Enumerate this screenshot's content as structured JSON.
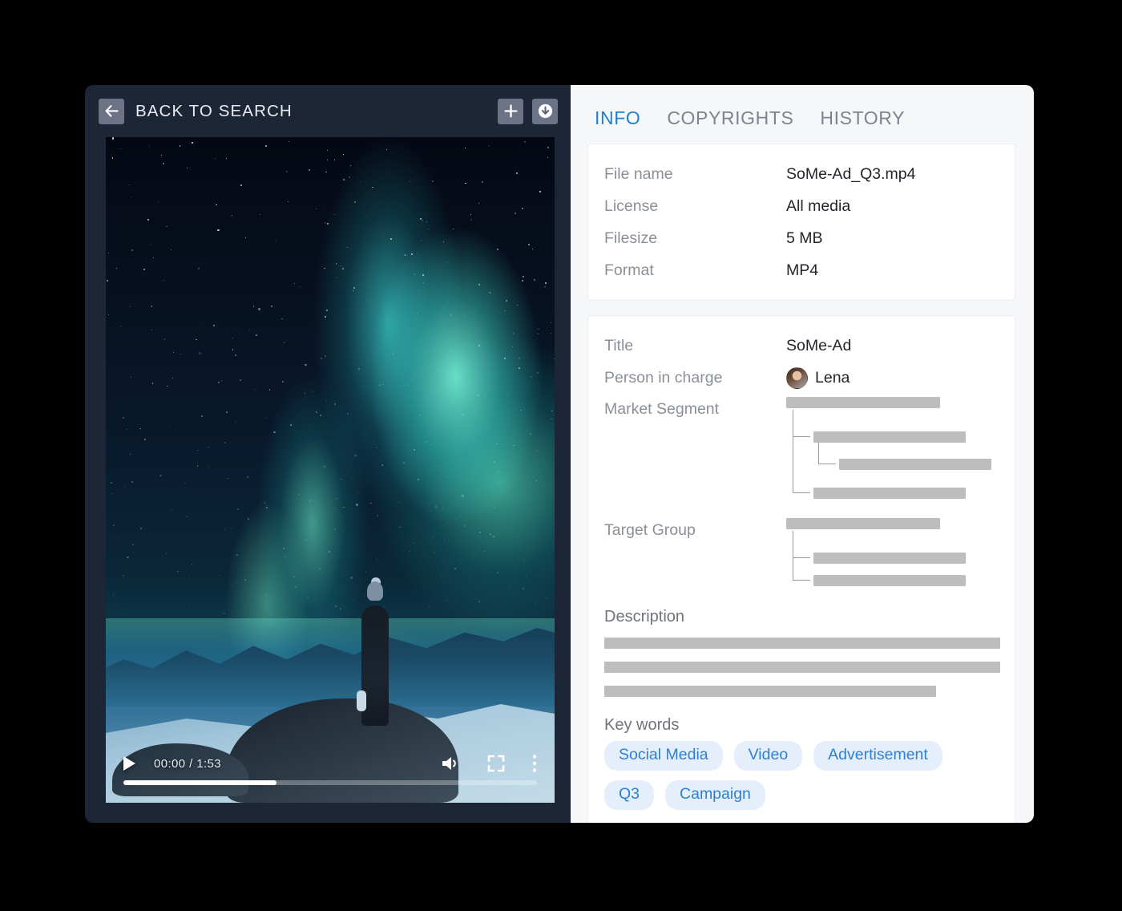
{
  "video_panel": {
    "back_button_label": "BACK TO SEARCH",
    "back_icon": "arrow-left-icon",
    "add_button_icon": "plus-icon",
    "download_button_icon": "download-circle-icon",
    "player": {
      "play_icon": "play-icon",
      "time_display": "00:00 / 1:53",
      "current_time": "00:00",
      "duration": "1:53",
      "volume_icon": "volume-icon",
      "fullscreen_icon": "fullscreen-icon",
      "more_icon": "kebab-menu-icon",
      "progress_percent": 37
    },
    "poster_alt": "Northern lights aurora over snowy mountains with a person standing on a rock"
  },
  "tabs": [
    {
      "label": "INFO",
      "active": true
    },
    {
      "label": "COPYRIGHTS",
      "active": false
    },
    {
      "label": "HISTORY",
      "active": false
    }
  ],
  "file_card": {
    "rows": [
      {
        "label": "File name",
        "value": "SoMe-Ad_Q3.mp4"
      },
      {
        "label": "License",
        "value": "All media"
      },
      {
        "label": "Filesize",
        "value": "5 MB"
      },
      {
        "label": "Format",
        "value": "MP4"
      }
    ]
  },
  "details_card": {
    "title_label": "Title",
    "title_value": "SoMe-Ad",
    "person_label": "Person in charge",
    "person_value": "Lena",
    "person_avatar": "avatar-lena",
    "market_segment_label": "Market Segment",
    "target_group_label": "Target Group",
    "description_label": "Description",
    "keywords_label": "Key words",
    "keywords": [
      "Social Media",
      "Video",
      "Advertisement",
      "Q3",
      "Campaign"
    ]
  },
  "colors": {
    "accent": "#2d80d2",
    "tab_active": "#1f7fd0",
    "panel_dark": "#1d2636",
    "panel_light": "#f6f7f9",
    "chip_bg": "#e4effb",
    "placeholder_bar": "#bdbdbd",
    "label_text": "#8b9097",
    "value_text": "#23262b"
  }
}
